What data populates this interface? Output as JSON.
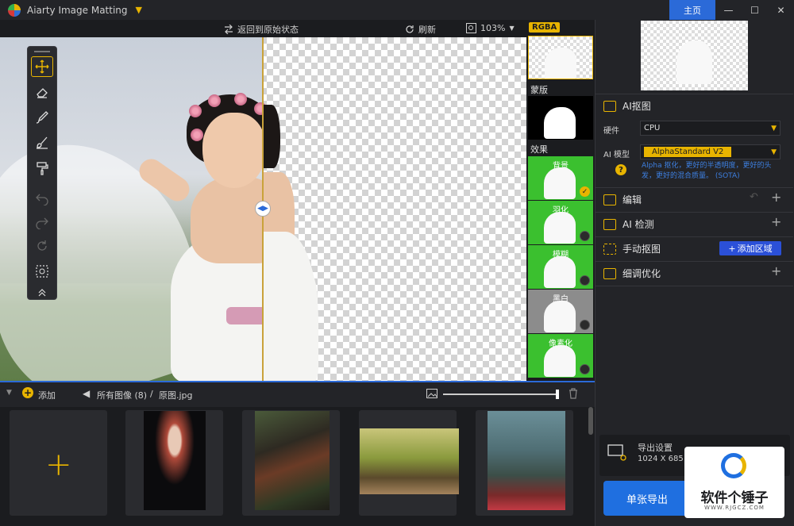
{
  "titlebar": {
    "app_title": "Aiarty Image Matting",
    "home_label": "主页",
    "minimize": "—",
    "maximize": "☐",
    "close": "✕"
  },
  "viewer_toolbar": {
    "reset_label": "返回到原始状态",
    "refresh_label": "刷新",
    "zoom_label": "103%"
  },
  "preview_strip": {
    "rgba_label": "RGBA",
    "mask_label": "蒙版",
    "effects_label": "效果",
    "effects": [
      {
        "label": "背景",
        "selected": true
      },
      {
        "label": "羽化",
        "selected": false
      },
      {
        "label": "模糊",
        "selected": false
      },
      {
        "label": "黑白",
        "selected": false
      },
      {
        "label": "像素化",
        "selected": false
      }
    ]
  },
  "right_panel": {
    "ai_matting_title": "AI抠图",
    "hardware_label": "硬件",
    "hardware_value": "CPU",
    "model_label": "AI 模型",
    "model_value": "AlphaStandard  V2",
    "model_desc": "Alpha 抠化，更好的半透明度，更好的头发，更好的混合质量。 (SOTA)",
    "edit_label": "编辑",
    "ai_detect_label": "AI 检测",
    "manual_label": "手动抠图",
    "add_area_label": "添加区域",
    "refine_label": "细调优化",
    "export_title": "导出设置",
    "export_size": "1024 X 685",
    "export_button": "单张导出"
  },
  "watermark": {
    "text": "软件个锤子",
    "url": "WWW.RJGCZ.COM"
  },
  "gallery_bar": {
    "add_label": "添加",
    "breadcrumb_all": "所有图像 (8)",
    "breadcrumb_sep": "/",
    "current_file": "原图.jpg"
  },
  "colors": {
    "accent": "#e8b400",
    "primary_blue": "#2b6ad8",
    "panel_bg": "#232428",
    "dark_bg": "#1b1c1f",
    "green_effect": "#3bc02f"
  },
  "icons": {
    "move": "move-icon",
    "eraser": "eraser-icon",
    "brush": "brush-icon",
    "restore": "restore-brush-icon",
    "paint": "paint-roller-icon",
    "undo": "undo-icon",
    "redo": "redo-icon",
    "reset": "reset-icon",
    "select": "select-frame-icon",
    "collapse": "collapse-icon"
  }
}
